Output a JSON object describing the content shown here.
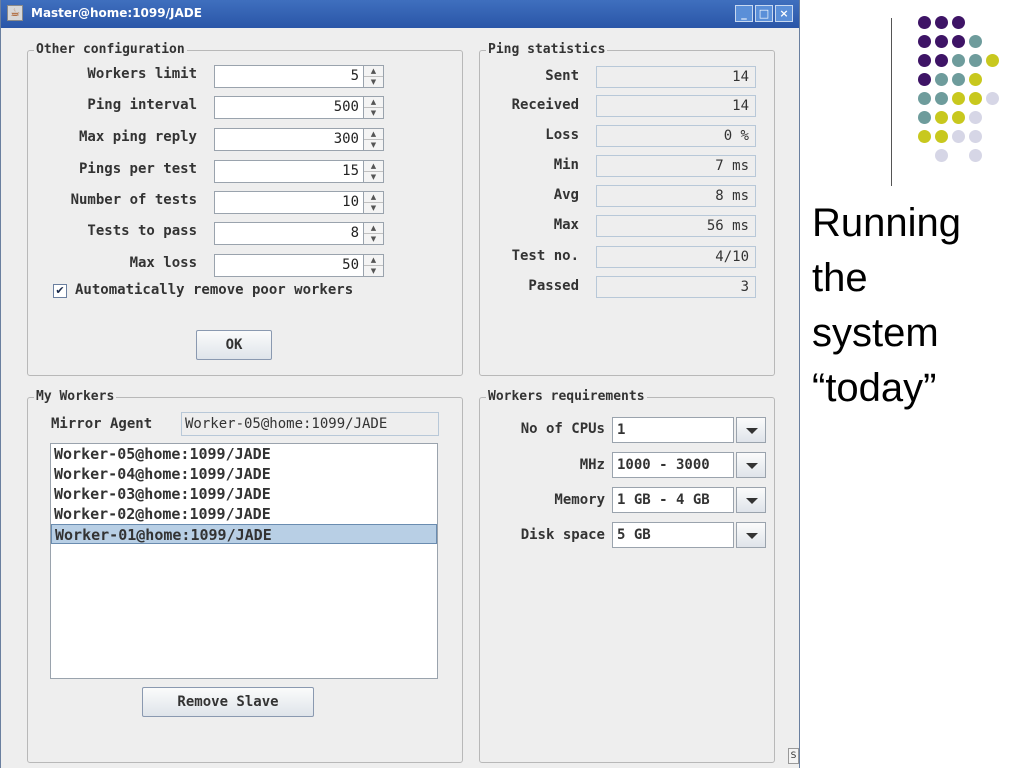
{
  "window": {
    "title": "Master@home:1099/JADE",
    "buttons": {
      "minimize": "_",
      "maximize": "□",
      "close": "×"
    }
  },
  "other_config": {
    "title": "Other configuration",
    "fields": [
      {
        "label": "Workers limit",
        "value": "5"
      },
      {
        "label": "Ping interval",
        "value": "500"
      },
      {
        "label": "Max ping reply",
        "value": "300"
      },
      {
        "label": "Pings per test",
        "value": "15"
      },
      {
        "label": "Number of tests",
        "value": "10"
      },
      {
        "label": "Tests to pass",
        "value": "8"
      },
      {
        "label": "Max loss",
        "value": "50"
      }
    ],
    "checkbox_label": "Automatically remove poor workers",
    "checkbox_checked": true,
    "ok_label": "OK"
  },
  "ping_stats": {
    "title": "Ping statistics",
    "rows": [
      {
        "label": "Sent",
        "value": "14"
      },
      {
        "label": "Received",
        "value": "14"
      },
      {
        "label": "Loss",
        "value": "0 %"
      },
      {
        "label": "Min",
        "value": "7 ms"
      },
      {
        "label": "Avg",
        "value": "8 ms"
      },
      {
        "label": "Max",
        "value": "56 ms"
      },
      {
        "label": "Test no.",
        "value": "4/10"
      },
      {
        "label": "Passed",
        "value": "3"
      }
    ]
  },
  "my_workers": {
    "title": "My Workers",
    "mirror_label": "Mirror Agent",
    "mirror_value": "Worker-05@home:1099/JADE",
    "workers": [
      "Worker-05@home:1099/JADE",
      "Worker-04@home:1099/JADE",
      "Worker-03@home:1099/JADE",
      "Worker-02@home:1099/JADE",
      "Worker-01@home:1099/JADE"
    ],
    "selected_index": 4,
    "remove_label": "Remove Slave"
  },
  "requirements": {
    "title": "Workers requirements",
    "rows": [
      {
        "label": "No of CPUs",
        "value": "1"
      },
      {
        "label": "MHz",
        "value": "1000 - 3000"
      },
      {
        "label": "Memory",
        "value": "1 GB - 4 GB"
      },
      {
        "label": "Disk space",
        "value": "5 GB"
      }
    ]
  },
  "resize_grip": "S",
  "slide": {
    "text_lines": [
      "Running",
      "the",
      "system",
      "“today”"
    ]
  },
  "colors": {
    "purple": "#3e1466",
    "teal": "#6e9c9c",
    "yellow": "#c8c81e",
    "lavender": "#d6d6e6"
  }
}
